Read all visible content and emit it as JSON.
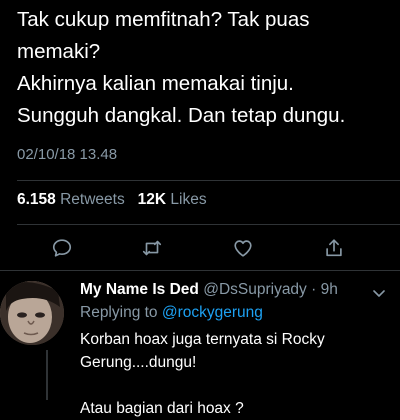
{
  "tweet": {
    "lines": [
      "Tak cukup memfitnah? Tak puas",
      "memaki?",
      "Akhirnya kalian memakai tinju.",
      "Sungguh dangkal. Dan tetap dungu."
    ],
    "timestamp": "02/10/18 13.48",
    "retweets_count": "6.158",
    "retweets_label": "Retweets",
    "likes_count": "12K",
    "likes_label": "Likes"
  },
  "actions": [
    "reply-icon",
    "retweet-icon",
    "like-icon",
    "share-icon"
  ],
  "reply": {
    "display_name": "My Name Is Ded",
    "handle_time": "@DsSupriyady · 9h",
    "replying_label": "Replying to",
    "replying_handle": "@rockygerung",
    "body_lines": [
      "Korban hoax juga ternyata si Rocky",
      "Gerung....dungu!",
      "",
      "Atau bagian dari hoax ?"
    ]
  },
  "colors": {
    "background": "#000000",
    "text": "#ffffff",
    "muted": "#8899a6",
    "link": "#1da1f2",
    "divider": "#2f3336"
  }
}
